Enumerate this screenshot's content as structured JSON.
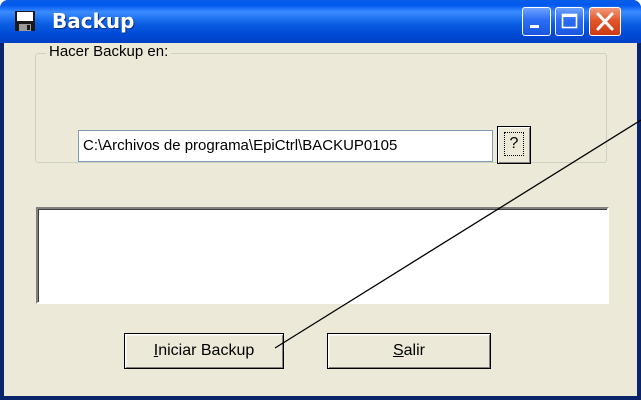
{
  "window": {
    "title": "Backup",
    "icons": {
      "app": "floppy-disk-icon",
      "minimize": "minimize-icon",
      "maximize": "maximize-icon",
      "close": "close-icon"
    }
  },
  "group": {
    "label": "Hacer Backup en:"
  },
  "path_field": {
    "value": "C:\\Archivos de programa\\EpiCtrl\\BACKUP0105"
  },
  "browse_button": {
    "label": "?"
  },
  "buttons": {
    "start": {
      "mnemonic": "I",
      "rest": "niciar Backup"
    },
    "exit": {
      "mnemonic": "S",
      "rest": "alir"
    }
  },
  "colors": {
    "titlebar": "#0058ee",
    "client": "#ece9d8",
    "close_button": "#e2572b"
  }
}
